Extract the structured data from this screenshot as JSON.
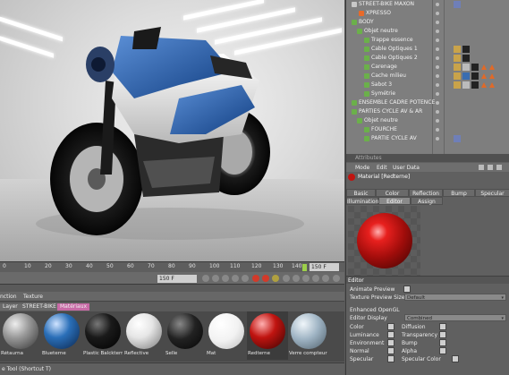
{
  "timeline": {
    "ticks": [
      "0",
      "10",
      "20",
      "30",
      "40",
      "50",
      "60",
      "70",
      "80",
      "90",
      "100",
      "110",
      "120",
      "130",
      "140"
    ],
    "end_frame": "150 F",
    "current_frame": "150 F"
  },
  "material_manager": {
    "menu": [
      "nction",
      "Texture"
    ],
    "tabs": [
      "Layer",
      "STREET-BIKE",
      "Matériaux"
    ],
    "materials": [
      {
        "name": "Rétaurna",
        "color": "#9a9a9a"
      },
      {
        "name": "Blueterne",
        "color": "#2a6fb8"
      },
      {
        "name": "Plastic Balckterne",
        "color": "#1a1a1a"
      },
      {
        "name": "Reflective",
        "color": "#e6e6e6"
      },
      {
        "name": "Selle",
        "color": "#222222"
      },
      {
        "name": "Mat",
        "color": "#f2f2f2"
      },
      {
        "name": "Redterne",
        "color": "#c01410"
      },
      {
        "name": "Verre compteur",
        "color": "#9fb4c4"
      }
    ]
  },
  "status_bar": {
    "text": "e Tool (Shortcut T)"
  },
  "objects": {
    "rows": [
      {
        "name": "STREET-BIKE MAXON",
        "indent": 14,
        "color": "#c8c8c8"
      },
      {
        "name": "XPRESSO",
        "indent": 22,
        "color": "#e86a2a"
      },
      {
        "name": "BODY",
        "indent": 14,
        "color": "#6bb04a"
      },
      {
        "name": "Objet neutre",
        "indent": 20,
        "color": "#6bb04a"
      },
      {
        "name": "Trappe essence",
        "indent": 28,
        "color": "#6bb04a"
      },
      {
        "name": "Cable Optiques 1",
        "indent": 28,
        "color": "#6bb04a"
      },
      {
        "name": "Cable Optiques 2",
        "indent": 28,
        "color": "#6bb04a"
      },
      {
        "name": "Carenage",
        "indent": 28,
        "color": "#6bb04a"
      },
      {
        "name": "Cache milieu",
        "indent": 28,
        "color": "#6bb04a"
      },
      {
        "name": "Sabot 3",
        "indent": 28,
        "color": "#6bb04a"
      },
      {
        "name": "Symétrie",
        "indent": 28,
        "color": "#6bb04a"
      },
      {
        "name": "ENSEMBLE CADRE POTENCE",
        "indent": 14,
        "color": "#6bb04a"
      },
      {
        "name": "PARTIES CYCLE AV & AR",
        "indent": 14,
        "color": "#6bb04a"
      },
      {
        "name": "Objet neutre",
        "indent": 20,
        "color": "#6bb04a"
      },
      {
        "name": "FOURCHE",
        "indent": 28,
        "color": "#6bb04a"
      },
      {
        "name": "PARTIE CYCLE AV",
        "indent": 28,
        "color": "#6bb04a"
      }
    ]
  },
  "attributes": {
    "header": "Attributes",
    "menu": [
      "Mode",
      "Edit",
      "User Data"
    ],
    "title": "Material [Redterne]",
    "tabs_row1": [
      "Basic",
      "Color",
      "Reflection",
      "Bump",
      "Specular"
    ],
    "tabs_row2": [
      "Illumination",
      "Editor",
      "Assign"
    ],
    "editor_label": "Editor",
    "animate_preview": "Animate Preview",
    "texture_preview_size": "Texture Preview Size",
    "texture_preview_value": "Default",
    "enhanced_opengl": "Enhanced OpenGL",
    "editor_display": "Editor Display",
    "editor_display_value": "Combined",
    "channels_left": [
      "Color",
      "Luminance",
      "Environment",
      "Normal",
      "Specular"
    ],
    "channels_right": [
      "Diffusion",
      "Transparency",
      "Bump",
      "Alpha",
      "Specular Color"
    ]
  },
  "colors": {
    "accent_green": "#9ccf4a",
    "material_red": "#c01410",
    "bike_blue": "#1f5aa8"
  }
}
